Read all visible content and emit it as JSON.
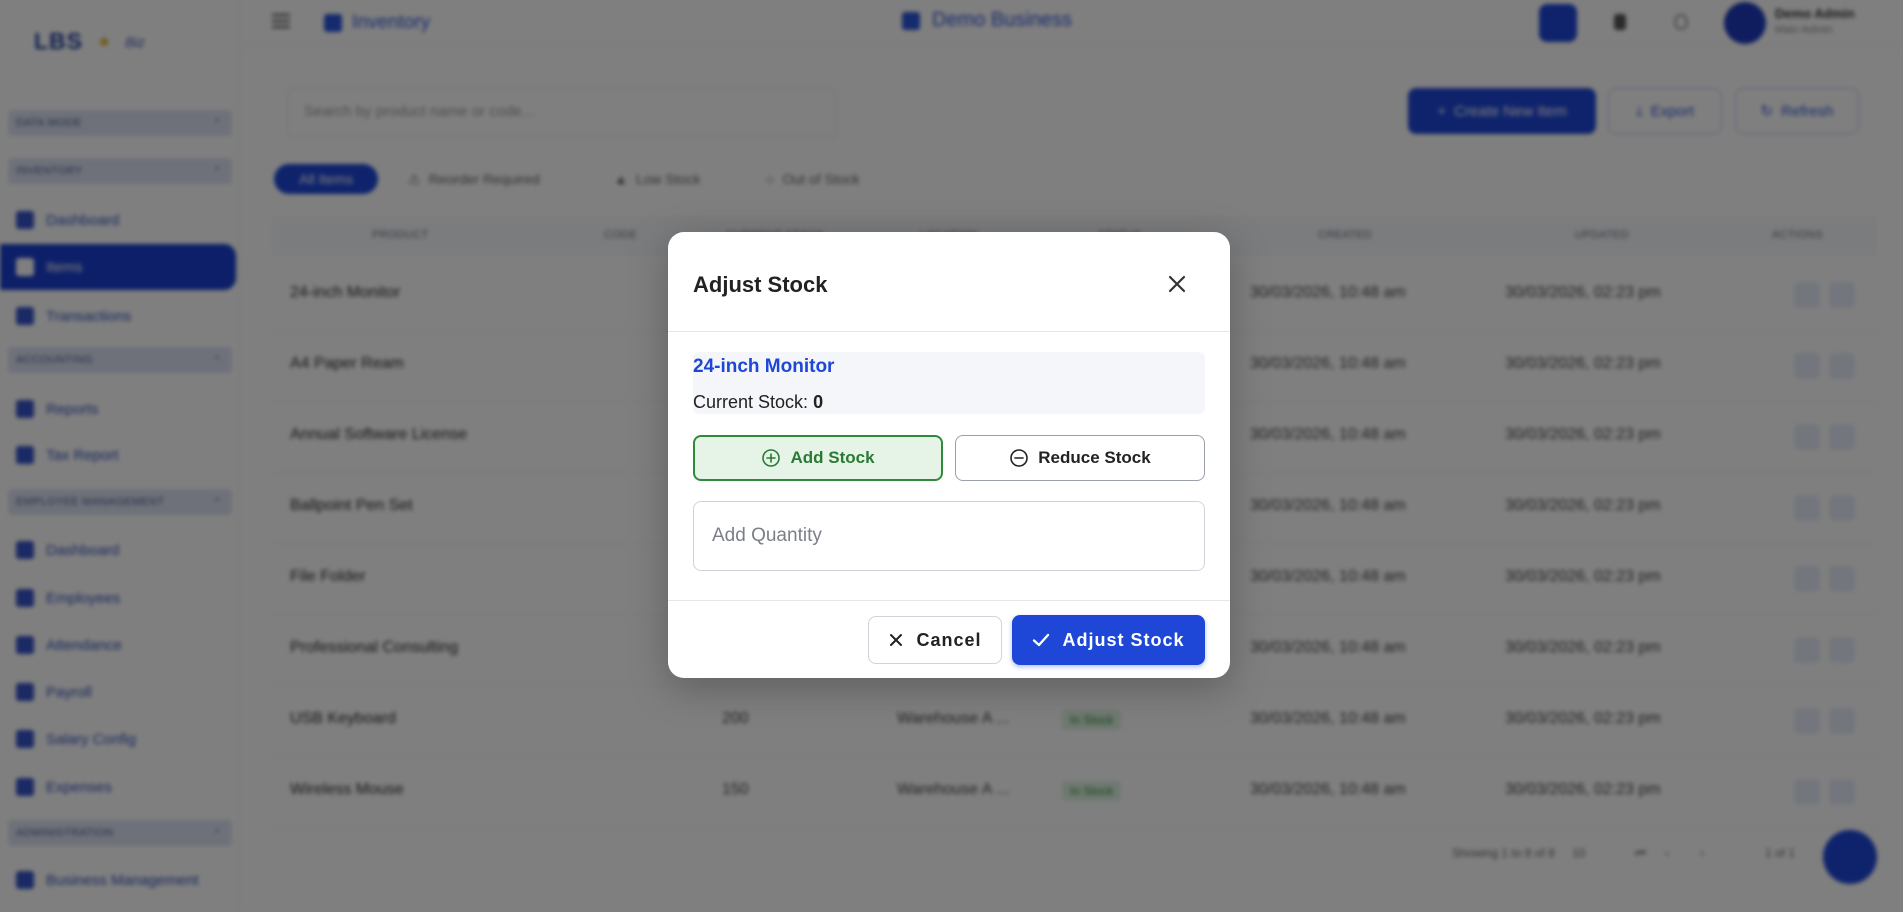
{
  "app": {
    "logo_text": "LBS",
    "logo_subtext": "Biz",
    "breadcrumb": "Inventory",
    "business_name": "Demo Business",
    "user_name": "Demo Admin",
    "user_role": "Main Admin"
  },
  "sidebar": {
    "sections": [
      "Data Mode",
      "Inventory",
      "Accounting",
      "Employee Management",
      "Administration"
    ],
    "items": [
      "Dashboard",
      "Items",
      "Transactions",
      "Reports",
      "Tax Report",
      "Dashboard",
      "Employees",
      "Attendance",
      "Payroll",
      "Salary Config",
      "Expenses",
      "Business Management"
    ]
  },
  "toolbar": {
    "search_placeholder": "Search by product name or code...",
    "create_label": "Create New Item",
    "export_label": "Export",
    "refresh_label": "Refresh"
  },
  "filters": [
    "All Items",
    "Reorder Required",
    "Low Stock",
    "Out of Stock"
  ],
  "table": {
    "columns": [
      "Product",
      "Code",
      "Current Stock",
      "Location",
      "Status",
      "Created",
      "Updated",
      "Actions"
    ],
    "rows": [
      {
        "product": "24-inch Monitor",
        "code": "",
        "location": "",
        "status": "",
        "created": "30/03/2026, 10:48 am",
        "updated": "30/03/2026, 02:23 pm"
      },
      {
        "product": "A4 Paper Ream",
        "code": "",
        "location": "",
        "status": "",
        "created": "30/03/2026, 10:48 am",
        "updated": "30/03/2026, 02:23 pm"
      },
      {
        "product": "Annual Software License",
        "code": "",
        "location": "",
        "status": "",
        "created": "30/03/2026, 10:48 am",
        "updated": "30/03/2026, 02:23 pm"
      },
      {
        "product": "Ballpoint Pen Set",
        "code": "",
        "location": "",
        "status": "",
        "created": "30/03/2026, 10:48 am",
        "updated": "30/03/2026, 02:23 pm"
      },
      {
        "product": "File Folder",
        "code": "",
        "location": "",
        "status": "",
        "created": "30/03/2026, 10:48 am",
        "updated": "30/03/2026, 02:23 pm"
      },
      {
        "product": "Professional Consulting",
        "code": "",
        "location": "",
        "status": "",
        "created": "30/03/2026, 10:48 am",
        "updated": "30/03/2026, 02:23 pm"
      },
      {
        "product": "USB Keyboard",
        "code": "200",
        "location": "Warehouse A ...",
        "status": "In Stock",
        "created": "30/03/2026, 10:48 am",
        "updated": "30/03/2026, 02:23 pm"
      },
      {
        "product": "Wireless Mouse",
        "code": "150",
        "location": "Warehouse A ...",
        "status": "In Stock",
        "created": "30/03/2026, 10:48 am",
        "updated": "30/03/2026, 02:23 pm"
      }
    ]
  },
  "pagination": {
    "summary": "Showing 1 to 8 of 8",
    "per_page": "10",
    "page": "1 of 1"
  },
  "modal": {
    "title": "Adjust Stock",
    "product_name": "24-inch Monitor",
    "current_stock_label": "Current Stock:",
    "current_stock_value": "0",
    "add_label": "Add Stock",
    "reduce_label": "Reduce Stock",
    "quantity_placeholder": "Add Quantity",
    "quantity_value": "",
    "cancel_label": "Cancel",
    "confirm_label": "Adjust Stock",
    "selected_mode": "add"
  },
  "colors": {
    "primary": "#1e47d8",
    "add_green": "#2f8a3c",
    "add_bg": "#e6f4e7"
  }
}
